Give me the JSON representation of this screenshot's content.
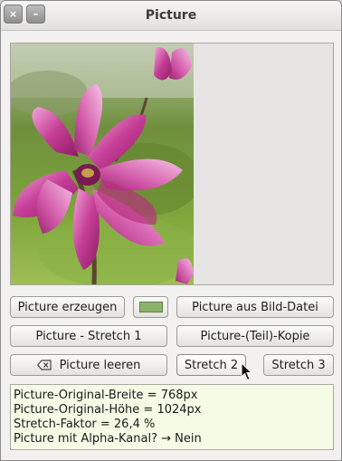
{
  "window": {
    "title": "Picture",
    "close_glyph": "×",
    "minimize_glyph": "–"
  },
  "picture": {
    "image": "magnolia-flower-photo"
  },
  "buttons": {
    "create": "Picture erzeugen",
    "from_file": "Picture aus Bild-Datei",
    "stretch1": "Picture - Stretch 1",
    "copy": "Picture-(Teil)-Kopie",
    "clear": "Picture leeren",
    "stretch2": "Stretch 2",
    "stretch3": "Stretch 3"
  },
  "swatch_color": "#8bb36b",
  "info": {
    "lines": [
      "Picture-Original-Breite = 768px",
      "Picture-Original-Höhe = 1024px",
      "Stretch-Faktor = 26,4 %",
      "Picture mit Alpha-Kanal? → Nein"
    ]
  }
}
